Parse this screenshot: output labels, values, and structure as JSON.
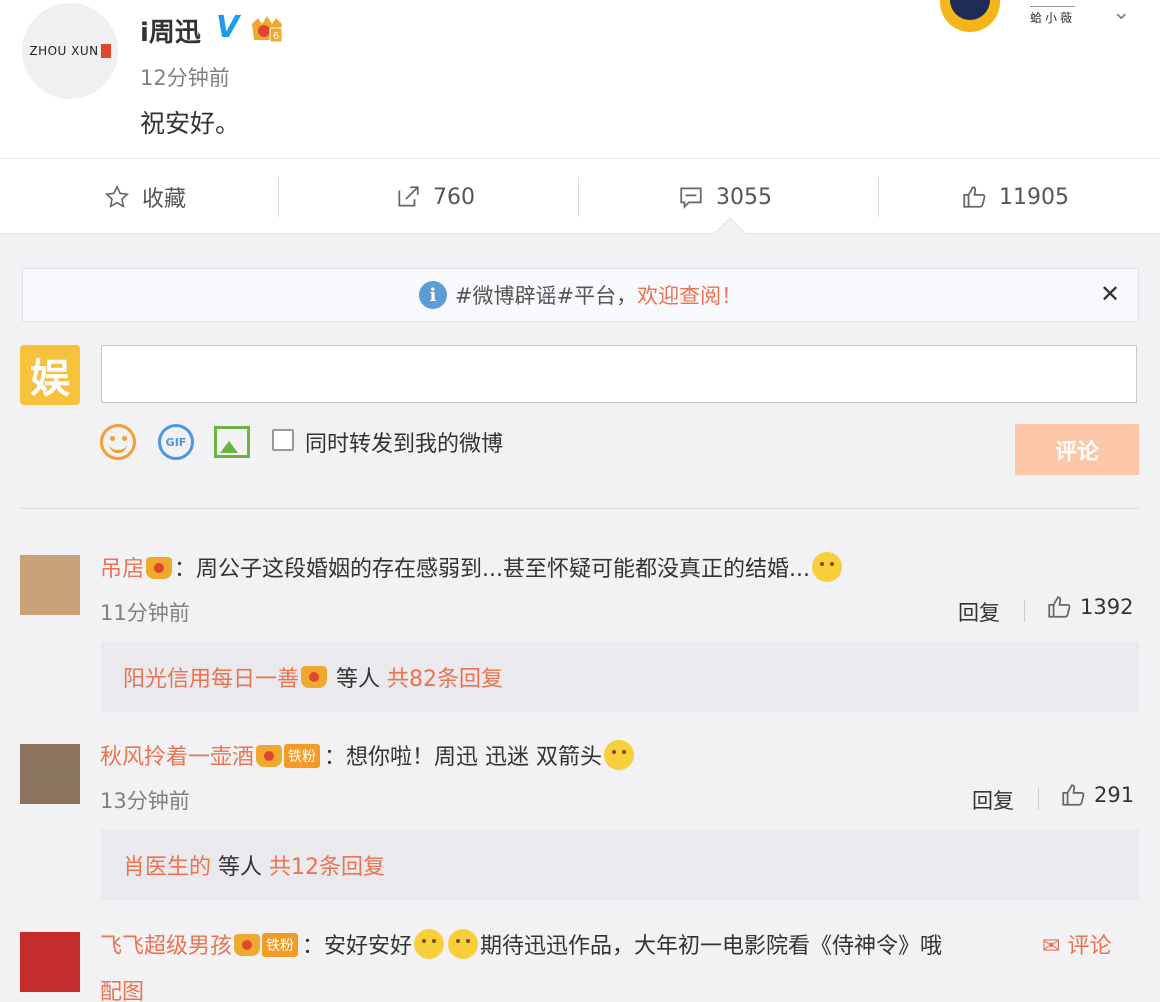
{
  "post": {
    "author": "i周迅",
    "avatar_text": "ZHOU XUN",
    "time": "12分钟前",
    "content": "祝安好。",
    "top_right_user": "蛤小薇"
  },
  "actions": {
    "favorite_label": "收藏",
    "repost_count": "760",
    "comment_count": "3055",
    "like_count": "11905"
  },
  "notice": {
    "text_prefix": "#微博辟谣#平台，",
    "text_highlight": "欢迎查阅！"
  },
  "composer": {
    "avatar_char": "娱",
    "placeholder": "",
    "gif_label": "GIF",
    "repost_label": "同时转发到我的微博",
    "submit_label": "评论"
  },
  "comments": [
    {
      "user": "吊扂",
      "text": "：周公子这段婚姻的存在感弱到...甚至怀疑可能都没真正的结婚...",
      "time": "11分钟前",
      "reply_label": "回复",
      "likes": "1392",
      "reply_summary": {
        "user": "阳光信用每日一善",
        "middle": "等人",
        "count_text": "共82条回复"
      }
    },
    {
      "user": "秋风拎着一壶酒",
      "fan_tag": "铁粉",
      "text": "：想你啦！周迅 迅迷  双箭头",
      "time": "13分钟前",
      "reply_label": "回复",
      "likes": "291",
      "reply_summary": {
        "user": "肖医生的",
        "middle": "等人",
        "count_text": "共12条回复"
      }
    },
    {
      "user": "飞飞超级男孩",
      "fan_tag": "铁粉",
      "text_a": "：安好安好",
      "text_b": "期待迅迅作品，大年初一电影院看《侍神令》哦",
      "comment_label": "评论",
      "extra": "配图"
    }
  ],
  "colors": {
    "accent": "#eb7350",
    "submit_bg": "#fbc7a7",
    "zone_bg": "#f2f2f5",
    "verify": "#1b9bf0"
  }
}
